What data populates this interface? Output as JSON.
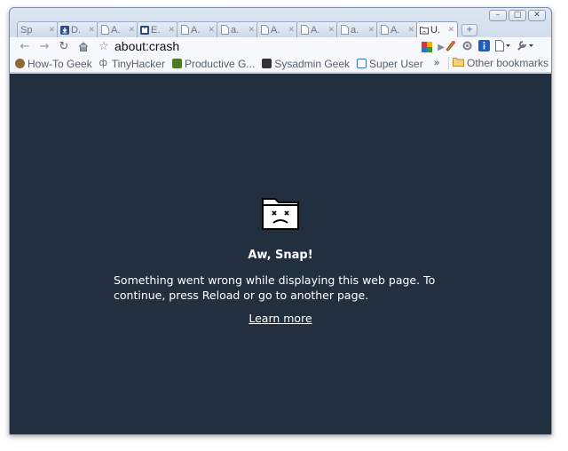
{
  "window": {
    "caption_buttons": [
      "minimize-icon",
      "maximize-icon",
      "close-icon"
    ]
  },
  "tabs": [
    {
      "title": "Sp",
      "icon": "blank-page-icon"
    },
    {
      "title": "D.",
      "icon": "download-icon"
    },
    {
      "title": "A.",
      "icon": "blank-page-icon"
    },
    {
      "title": "E.",
      "icon": "puzzle-icon"
    },
    {
      "title": "A.",
      "icon": "blank-page-icon"
    },
    {
      "title": "a.",
      "icon": "blank-page-icon"
    },
    {
      "title": "A.",
      "icon": "blank-page-icon"
    },
    {
      "title": "A.",
      "icon": "blank-page-icon"
    },
    {
      "title": "a.",
      "icon": "blank-page-icon"
    },
    {
      "title": "A.",
      "icon": "blank-page-icon"
    },
    {
      "title": "U.",
      "icon": "sad-folder-icon",
      "active": true
    }
  ],
  "toolbar": {
    "url": "about:crash"
  },
  "bookmarks": [
    {
      "label": "How-To Geek",
      "color": "#8a6a3a"
    },
    {
      "label": "TinyHacker",
      "color": "#666666"
    },
    {
      "label": "Productive G...",
      "color": "#4b7a2a"
    },
    {
      "label": "Sysadmin Geek",
      "color": "#333333"
    },
    {
      "label": "Super User",
      "color": "#3a6fb0"
    }
  ],
  "bookmarks_more": "»",
  "other_bookmarks": "Other bookmarks",
  "crash": {
    "headline": "Aw, Snap!",
    "message": "Something went wrong while displaying this web page. To continue, press Reload or go to another page.",
    "learn_more": "Learn more"
  },
  "colors": {
    "content_bg": "#222f3f",
    "text": "#ffffff"
  }
}
